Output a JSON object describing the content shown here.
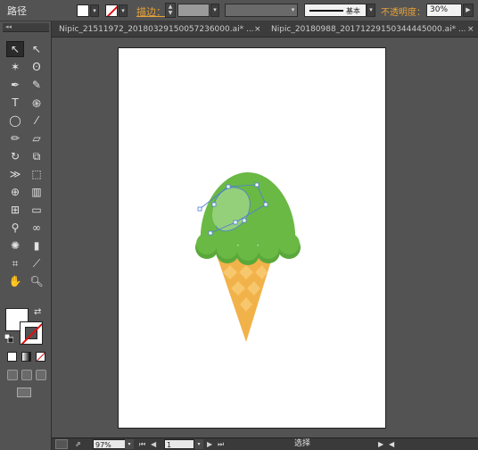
{
  "control_bar": {
    "selection_label": "路径",
    "stroke_label": "描边：",
    "brush_label": "基本",
    "opacity_label": "不透明度：",
    "opacity_value": "30%"
  },
  "tabs": [
    {
      "label": "Nipic_21511972_20180329150057236000.ai* ...",
      "close": "×"
    },
    {
      "label": "Nipic_20180988_20171229150344445000.ai* ...",
      "close": "×"
    }
  ],
  "toolbar": {
    "grip": "◂◂",
    "tools": [
      {
        "name": "selection-tool",
        "glyph": "↖",
        "active": true
      },
      {
        "name": "direct-selection-tool",
        "glyph": "↖"
      },
      {
        "name": "magic-wand-tool",
        "glyph": "✶"
      },
      {
        "name": "lasso-tool",
        "glyph": "ʘ"
      },
      {
        "name": "pen-tool",
        "glyph": "✒"
      },
      {
        "name": "curvature-tool",
        "glyph": "✎"
      },
      {
        "name": "type-tool",
        "glyph": "T"
      },
      {
        "name": "spiral-tool",
        "glyph": "֍"
      },
      {
        "name": "ellipse-tool",
        "glyph": "◯"
      },
      {
        "name": "paintbrush-tool",
        "glyph": "⁄"
      },
      {
        "name": "pencil-tool",
        "glyph": "✏"
      },
      {
        "name": "eraser-tool",
        "glyph": "▱"
      },
      {
        "name": "rotate-tool",
        "glyph": "↻"
      },
      {
        "name": "scale-tool",
        "glyph": "⧉"
      },
      {
        "name": "width-tool",
        "glyph": "≫"
      },
      {
        "name": "free-transform-tool",
        "glyph": "⬚"
      },
      {
        "name": "shape-builder-tool",
        "glyph": "⊕"
      },
      {
        "name": "perspective-grid-tool",
        "glyph": "▥"
      },
      {
        "name": "mesh-tool",
        "glyph": "⊞"
      },
      {
        "name": "gradient-tool",
        "glyph": "▭"
      },
      {
        "name": "eyedropper-tool",
        "glyph": "⚲"
      },
      {
        "name": "blend-tool",
        "glyph": "∞"
      },
      {
        "name": "symbol-sprayer-tool",
        "glyph": "✺"
      },
      {
        "name": "column-graph-tool",
        "glyph": "▮"
      },
      {
        "name": "artboard-tool",
        "glyph": "⌗"
      },
      {
        "name": "slice-tool",
        "glyph": "⟋"
      },
      {
        "name": "hand-tool",
        "glyph": "✋"
      },
      {
        "name": "zoom-tool",
        "glyph": "🔍︎"
      }
    ]
  },
  "status_bar": {
    "zoom": "97%",
    "page": "1",
    "status_text": "选择",
    "first": "⏮",
    "prev": "◀",
    "next": "▶",
    "last": "⏭",
    "arrow": "▶",
    "scroll_left": "◀"
  },
  "colors": {
    "ui_bg": "#535353",
    "scoop_green": "#6ab945",
    "scoop_highlight": "#94d07a",
    "cone_orange": "#f2b24a",
    "accent_orange": "#e8a33a"
  }
}
